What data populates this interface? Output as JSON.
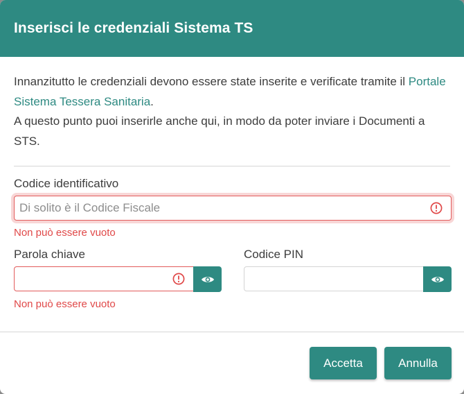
{
  "dialog": {
    "title": "Inserisci le credenziali Sistema TS",
    "intro_part1": "Innanzitutto le credenziali devono essere state inserite e verificate tramite il ",
    "intro_link": "Portale Sistema Tessera Sanitaria",
    "intro_part2": ".",
    "intro_line3": "A questo punto puoi inserirle anche qui, in modo da poter inviare i Documenti a STS."
  },
  "form": {
    "codice": {
      "label": "Codice identificativo",
      "placeholder": "Di solito è il Codice Fiscale",
      "value": "",
      "error": "Non può essere vuoto"
    },
    "parola": {
      "label": "Parola chiave",
      "value": "",
      "error": "Non può essere vuoto"
    },
    "pin": {
      "label": "Codice PIN",
      "value": ""
    }
  },
  "footer": {
    "accept_label": "Accetta",
    "cancel_label": "Annulla"
  },
  "colors": {
    "primary": "#2e8a82",
    "error": "#e04848"
  },
  "icons": {
    "error": "exclamation-circle-icon",
    "reveal": "eye-icon"
  }
}
